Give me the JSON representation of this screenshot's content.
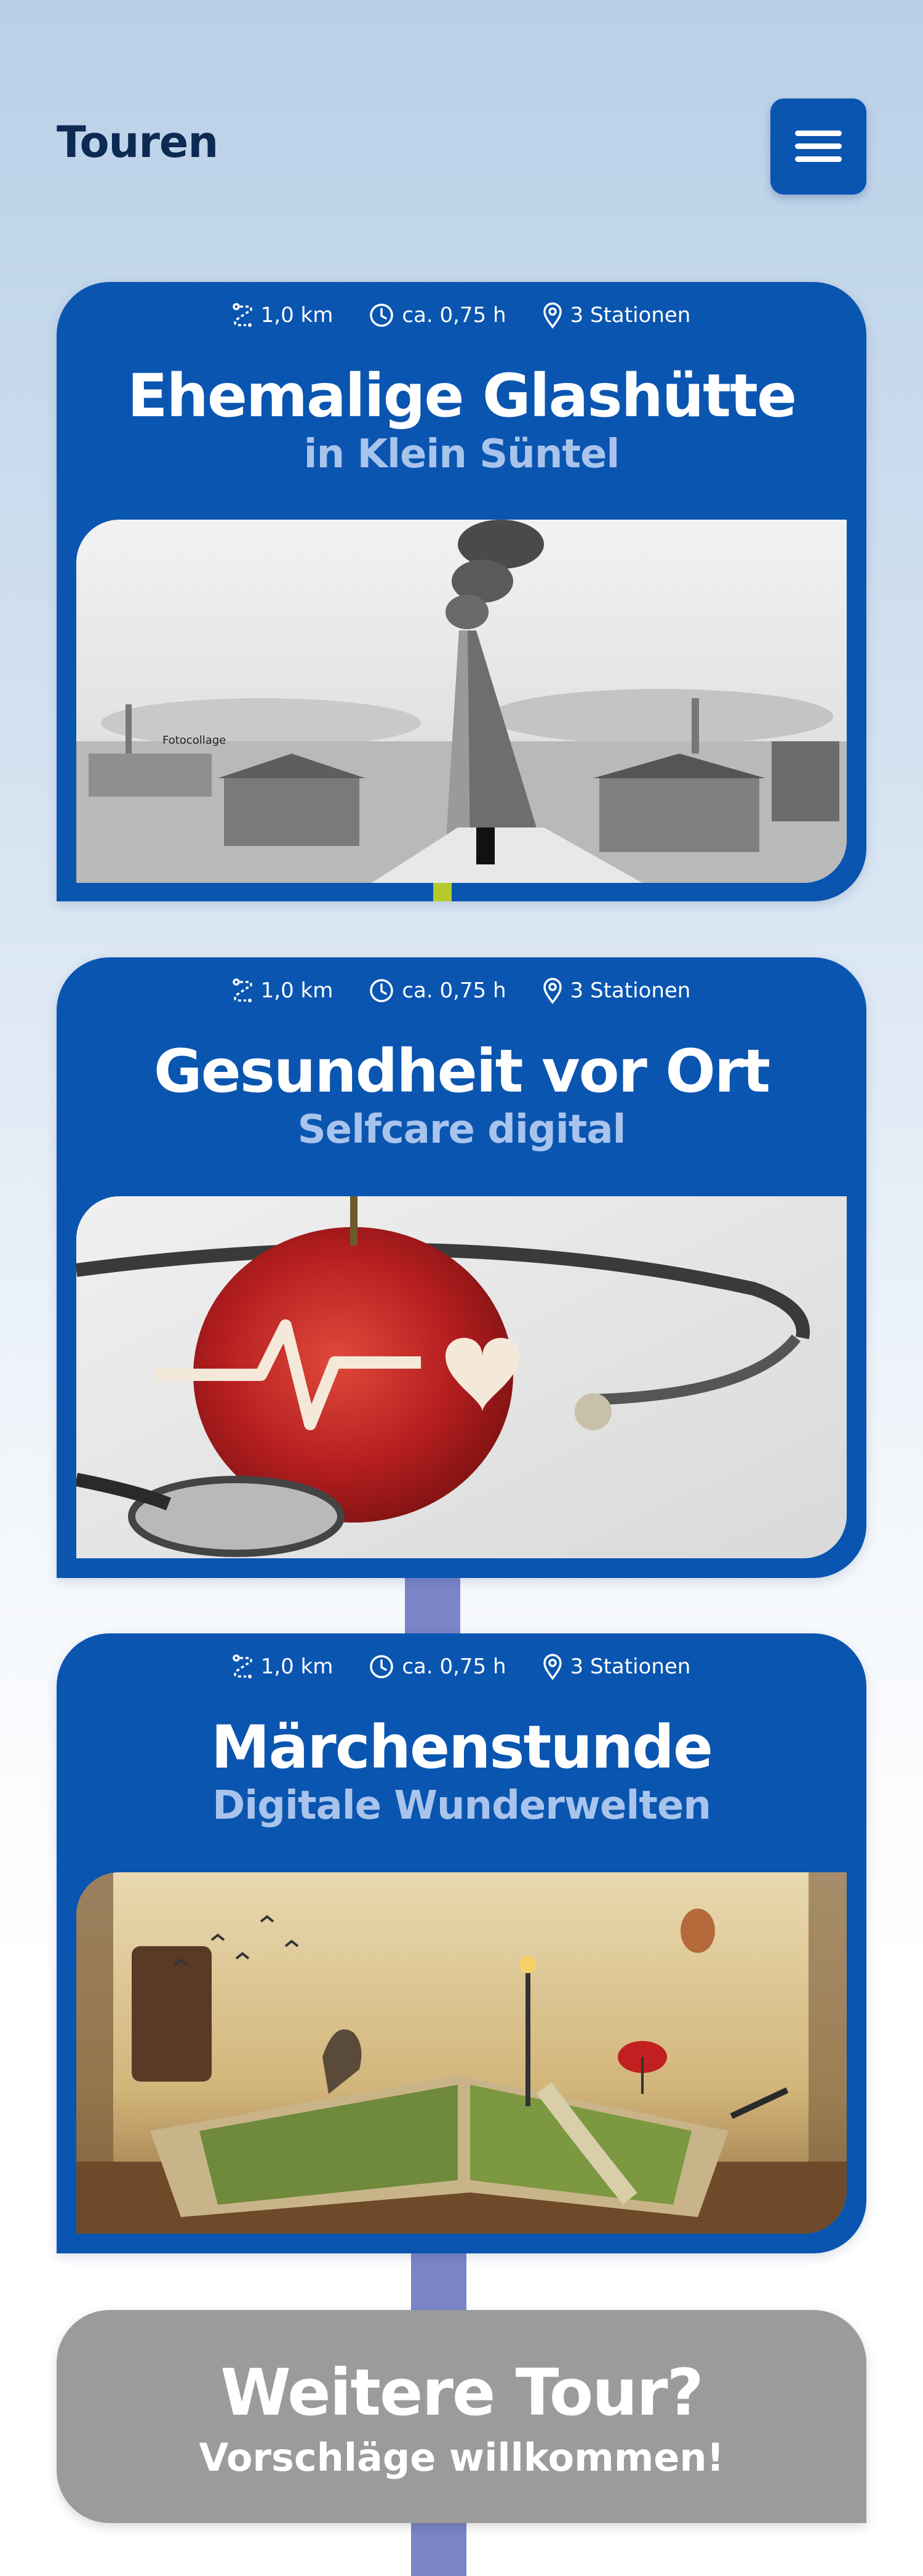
{
  "header": {
    "title": "Touren"
  },
  "colors": {
    "card_blue": "#0a55b0",
    "subtitle_blue": "#a9c4ec",
    "pole": "#7a86c8",
    "accent_green": "#b5c92a",
    "more_gray": "#9b9b9b"
  },
  "icons": {
    "menu": "hamburger-icon",
    "distance": "route-icon",
    "duration": "clock-icon",
    "stations": "map-pin-icon"
  },
  "tours": [
    {
      "distance": "1,0 km",
      "duration": "ca. 0,75 h",
      "stations": "3 Stationen",
      "title": "Ehemalige Glashütte",
      "subtitle": "in Klein Süntel",
      "image_caption": "Fotocollage"
    },
    {
      "distance": "1,0 km",
      "duration": "ca. 0,75 h",
      "stations": "3 Stationen",
      "title": "Gesundheit vor Ort",
      "subtitle": "Selfcare digital"
    },
    {
      "distance": "1,0 km",
      "duration": "ca. 0,75 h",
      "stations": "3 Stationen",
      "title": "Märchenstunde",
      "subtitle": "Digitale Wunderwelten"
    }
  ],
  "more": {
    "title": "Weitere Tour?",
    "subtitle": "Vorschläge willkommen!"
  }
}
